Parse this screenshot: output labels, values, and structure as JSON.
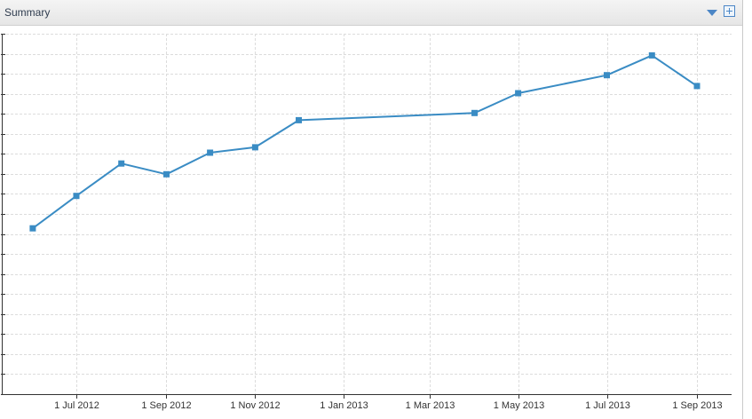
{
  "panel": {
    "title": "Summary"
  },
  "icons": {
    "collapse": "triangle-down-icon",
    "expand": "plus-box-icon"
  },
  "colors": {
    "series": "#3a8cc4",
    "grid": "#dcdcdc",
    "axis": "#333333",
    "header_text": "#2e3b4e"
  },
  "chart_data": {
    "type": "line",
    "title": "",
    "xlabel": "",
    "ylabel": "",
    "grid": true,
    "legend": "none",
    "x_ticks": [
      "1 Jul 2012",
      "1 Sep 2012",
      "1 Nov 2012",
      "1 Jan 2013",
      "1 Mar 2013",
      "1 May 2013",
      "1 Jul 2013",
      "1 Sep 2013"
    ],
    "y_ticks_labeled": false,
    "series": [
      {
        "points": [
          {
            "x": "2012-06-01",
            "y": 46
          },
          {
            "x": "2012-07-01",
            "y": 55
          },
          {
            "x": "2012-08-01",
            "y": 64
          },
          {
            "x": "2012-09-01",
            "y": 61
          },
          {
            "x": "2012-10-01",
            "y": 67
          },
          {
            "x": "2012-11-01",
            "y": 68.5
          },
          {
            "x": "2012-12-01",
            "y": 76
          },
          {
            "x": "2013-04-01",
            "y": 78
          },
          {
            "x": "2013-05-01",
            "y": 83.5
          },
          {
            "x": "2013-07-01",
            "y": 88.5
          },
          {
            "x": "2013-08-01",
            "y": 94
          },
          {
            "x": "2013-09-01",
            "y": 85.5
          }
        ]
      }
    ]
  }
}
